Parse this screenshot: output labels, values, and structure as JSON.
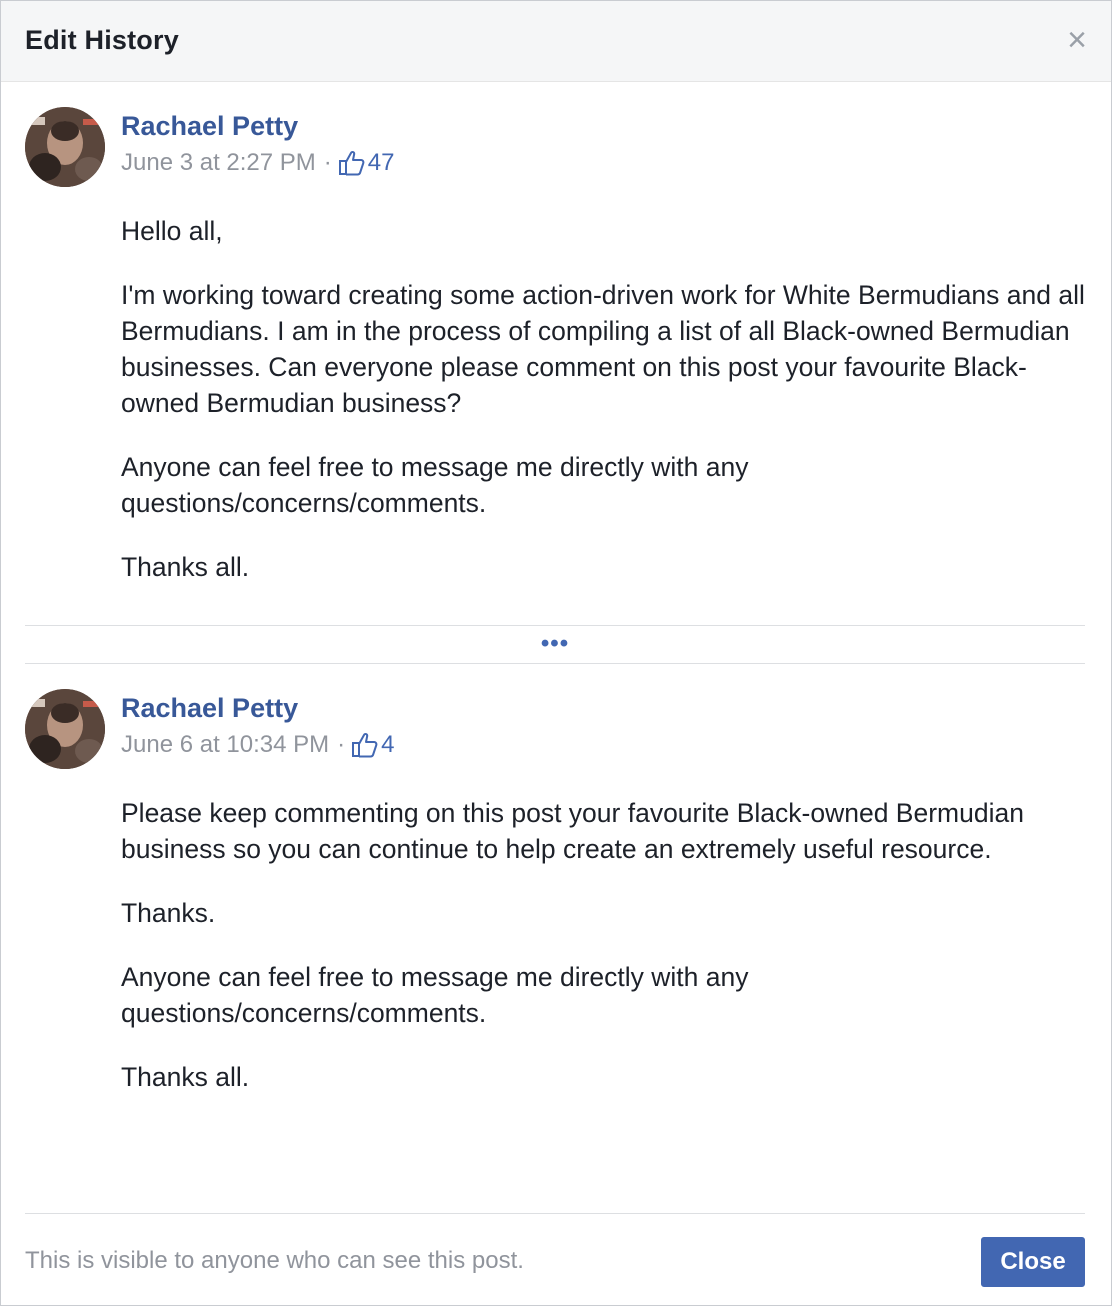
{
  "dialog": {
    "title": "Edit History",
    "close_icon": "close-icon",
    "more_indicator": "•••",
    "footer_text": "This is visible to anyone who can see this post.",
    "close_button_label": "Close"
  },
  "revisions": [
    {
      "author": "Rachael Petty",
      "timestamp": "June 3 at 2:27 PM",
      "separator": "·",
      "likes": "47",
      "paragraphs": [
        "Hello all,",
        "I'm working toward creating some action-driven work for White Bermudians and all Bermudians. I am in the process of compiling a list of all Black-owned Bermudian businesses. Can everyone please comment on this post your favourite Black-owned Bermudian business?",
        "Anyone can feel free to message me directly with any questions/concerns/comments.",
        "Thanks all."
      ]
    },
    {
      "author": "Rachael Petty",
      "timestamp": "June 6 at 10:34 PM",
      "separator": "·",
      "likes": "4",
      "paragraphs": [
        "Please keep commenting on this post your favourite Black-owned Bermudian business so you can continue to help create an extremely useful resource.",
        "Thanks.",
        "Anyone can feel free to message me directly with any questions/concerns/comments.",
        "Thanks all."
      ]
    }
  ],
  "colors": {
    "author_link": "#385898",
    "accent": "#4267b2",
    "meta_text": "#90949c",
    "body_text": "#1d2129"
  }
}
